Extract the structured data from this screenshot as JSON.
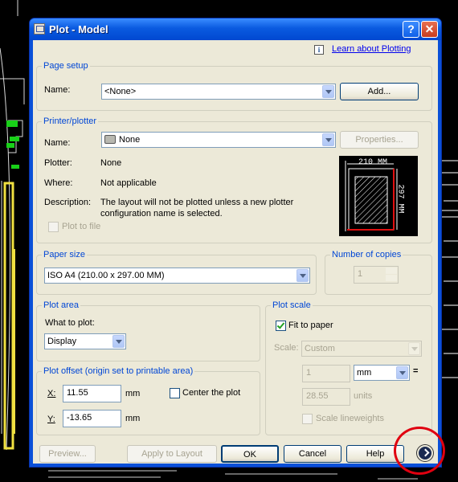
{
  "window": {
    "title": "Plot - Model",
    "help_btn": "?",
    "close_btn": "✕"
  },
  "top_link": {
    "text": "Learn about Plotting",
    "icon": "info-icon"
  },
  "page_setup": {
    "legend": "Page setup",
    "name_label": "Name:",
    "name_value": "<None>",
    "add_button": "Add..."
  },
  "printer": {
    "legend": "Printer/plotter",
    "name_label": "Name:",
    "name_value": "None",
    "properties_button": "Properties...",
    "plotter_label": "Plotter:",
    "plotter_value": "None",
    "where_label": "Where:",
    "where_value": "Not applicable",
    "description_label": "Description:",
    "description_line1": "The layout will not be plotted unless a new plotter",
    "description_line2": "configuration name is selected.",
    "plot_to_file": "Plot to file",
    "preview_width": "210 MM",
    "preview_height": "297 MM"
  },
  "paper_size": {
    "legend": "Paper size",
    "value": "ISO A4 (210.00 x 297.00 MM)"
  },
  "copies": {
    "legend": "Number of copies",
    "value": "1"
  },
  "plot_area": {
    "legend": "Plot area",
    "what_label": "What to plot:",
    "what_value": "Display"
  },
  "plot_scale": {
    "legend": "Plot scale",
    "fit_to_paper": "Fit to paper",
    "fit_checked": true,
    "scale_label": "Scale:",
    "scale_value": "Custom",
    "value1": "1",
    "unit1": "mm",
    "equals": "=",
    "value2": "28.55",
    "unit2": "units",
    "scale_lineweights": "Scale lineweights"
  },
  "plot_offset": {
    "legend": "Plot offset (origin set to printable area)",
    "x_label": "X:",
    "x_value": "11.55",
    "x_unit": "mm",
    "y_label": "Y:",
    "y_value": "-13.65",
    "y_unit": "mm",
    "center_label": "Center the plot"
  },
  "buttons": {
    "preview": "Preview...",
    "apply": "Apply to Layout",
    "ok": "OK",
    "cancel": "Cancel",
    "help": "Help"
  },
  "colors": {
    "title_bar": "#0a5ae0",
    "dialog_bg": "#ece9d8",
    "group_label": "#0046d5",
    "highlight_ring": "#e00010"
  }
}
